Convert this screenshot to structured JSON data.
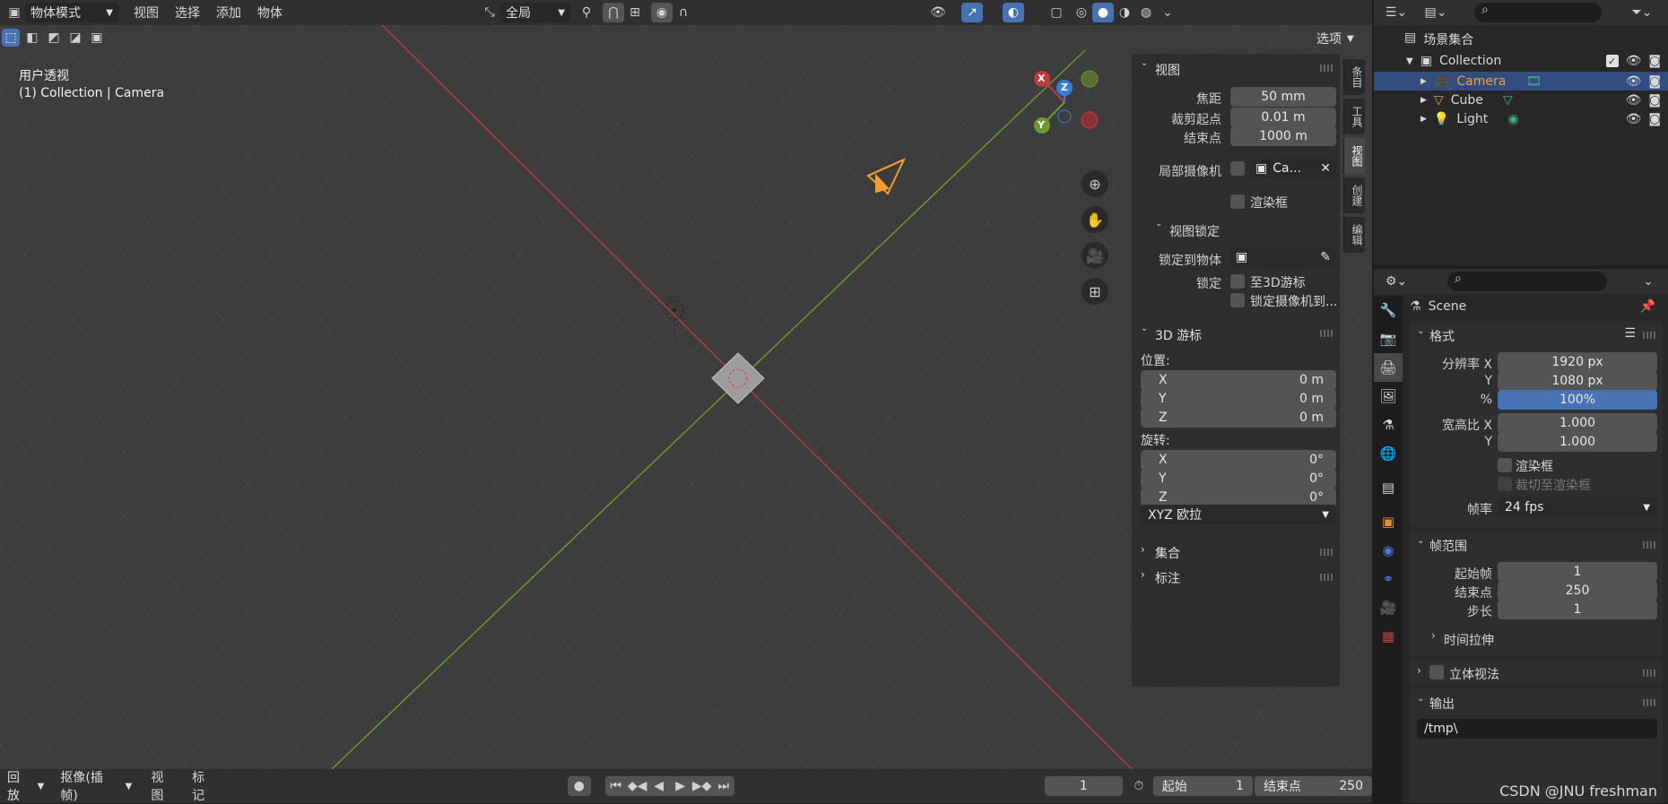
{
  "topbar": {
    "mode": "物体模式",
    "menus": [
      "视图",
      "选择",
      "添加",
      "物体"
    ],
    "orientation": "全局",
    "options": "选项"
  },
  "viewport": {
    "title": "用户透视",
    "subtitle": "(1) Collection | Camera",
    "gizmo": {
      "x": "X",
      "y": "Y",
      "z": "Z"
    }
  },
  "npanel": {
    "view_header": "视图",
    "focal_label": "焦距",
    "focal_value": "50 mm",
    "clip_start_label": "裁剪起点",
    "clip_start_value": "0.01 m",
    "clip_end_label": "结束点",
    "clip_end_value": "1000 m",
    "local_camera_label": "局部摄像机",
    "local_camera_value": "Ca...",
    "render_border_label": "渲染框",
    "view_lock_header": "视图锁定",
    "lock_object_label": "锁定到物体",
    "lock_label": "锁定",
    "lock_cursor_label": "至3D游标",
    "lock_camera_label": "锁定摄像机到...",
    "cursor_header": "3D 游标",
    "location_label": "位置:",
    "loc": [
      {
        "axis": "X",
        "value": "0 m"
      },
      {
        "axis": "Y",
        "value": "0 m"
      },
      {
        "axis": "Z",
        "value": "0 m"
      }
    ],
    "rotation_label": "旋转:",
    "rot": [
      {
        "axis": "X",
        "value": "0°"
      },
      {
        "axis": "Y",
        "value": "0°"
      },
      {
        "axis": "Z",
        "value": "0°"
      }
    ],
    "rotation_mode": "XYZ 欧拉",
    "collection_header": "集合",
    "annotation_header": "标注"
  },
  "side_tabs": [
    "条目",
    "工具",
    "视图",
    "创建",
    "编辑"
  ],
  "outliner": {
    "root": "场景集合",
    "collection": "Collection",
    "items": [
      {
        "name": "Camera",
        "selected": true,
        "color": "#e8a23c"
      },
      {
        "name": "Cube",
        "selected": false,
        "color": "#e8a23c"
      },
      {
        "name": "Light",
        "selected": false,
        "color": "#e8a23c"
      }
    ]
  },
  "properties": {
    "scene": "Scene",
    "format_header": "格式",
    "res_x_label": "分辨率 X",
    "res_x": "1920 px",
    "res_y_label": "Y",
    "res_y": "1080 px",
    "pct_label": "%",
    "pct": "100%",
    "aspect_x_label": "宽高比 X",
    "aspect_x": "1.000",
    "aspect_y_label": "Y",
    "aspect_y": "1.000",
    "render_border": "渲染框",
    "crop_border": "裁切至渲染框",
    "fps_label": "帧率",
    "fps": "24 fps",
    "frame_range_header": "帧范围",
    "start_label": "起始帧",
    "start": "1",
    "end_label": "结束点",
    "end": "250",
    "step_label": "步长",
    "step": "1",
    "time_stretch": "时间拉伸",
    "stereo": "立体视法",
    "output_header": "输出",
    "output_path": "/tmp\\"
  },
  "timeline": {
    "playback": "回放",
    "keying": "抠像(插帧)",
    "view": "视图",
    "marker": "标记",
    "current_frame": "1",
    "start_label": "起始",
    "start": "1",
    "end_label": "结束点",
    "end": "250"
  },
  "watermark": "CSDN @JNU freshman",
  "colors": {
    "accent": "#4772b3",
    "x_axis": "#c0393f",
    "y_axis": "#6a9a2a"
  }
}
